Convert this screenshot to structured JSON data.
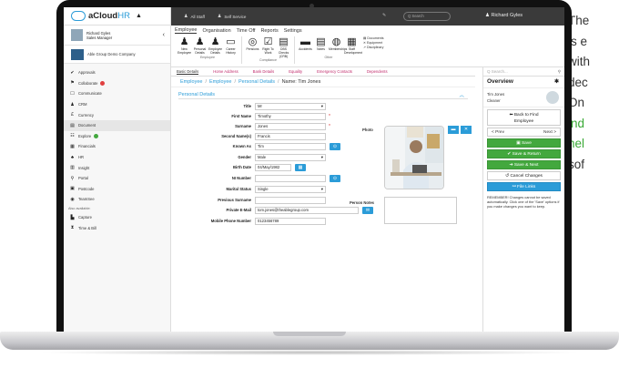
{
  "side_text": {
    "lines": [
      "The",
      "is e",
      "with",
      "dec",
      "On",
      "ind",
      "hel",
      "sof"
    ]
  },
  "sidebar": {
    "logo_a": "aCloud",
    "logo_b": "HR",
    "user_name_line1": "Richard Gyles",
    "user_name_line2": "Sales Manager",
    "company": "Able Group Demo Company",
    "items": [
      {
        "label": "Approvals",
        "icon": "check-circle-icon",
        "glyph": "✔"
      },
      {
        "label": "Collaborate",
        "icon": "people-icon",
        "glyph": "⚑",
        "badge": "#e04040"
      },
      {
        "label": "Communicate",
        "icon": "chat-icon",
        "glyph": "☐"
      },
      {
        "label": "CRM",
        "icon": "crm-icon",
        "glyph": "♟"
      },
      {
        "label": "Currency",
        "icon": "currency-icon",
        "glyph": "£"
      },
      {
        "label": "Document",
        "icon": "document-icon",
        "glyph": "▤",
        "active": true
      },
      {
        "label": "Explore",
        "icon": "explore-icon",
        "glyph": "☷",
        "badge": "#43a83e"
      },
      {
        "label": "Financials",
        "icon": "financials-icon",
        "glyph": "▦"
      },
      {
        "label": "HR",
        "icon": "hr-icon",
        "glyph": "♣"
      },
      {
        "label": "Insight",
        "icon": "insight-icon",
        "glyph": "▥"
      },
      {
        "label": "Portal",
        "icon": "portal-icon",
        "glyph": "⚲"
      },
      {
        "label": "Postcode",
        "icon": "postcode-icon",
        "glyph": "▣"
      },
      {
        "label": "TeamSee",
        "icon": "teamsee-icon",
        "glyph": "◉"
      }
    ],
    "also_available": "Also available:",
    "extra_items": [
      {
        "label": "Capture",
        "icon": "capture-icon",
        "glyph": "▙"
      },
      {
        "label": "Time & Bill",
        "icon": "hourglass-icon",
        "glyph": "⧗"
      }
    ]
  },
  "topbar": {
    "all_staff": "All Staff",
    "self_service": "Self Service",
    "search_placeholder": "Q Search",
    "user": "Richard Gyles"
  },
  "ribbon": {
    "tabs": [
      "Employee",
      "Organisation",
      "Time Off",
      "Reports",
      "Settings"
    ],
    "employee_buttons": [
      {
        "label": "New Employee",
        "icon": "new-employee-icon"
      },
      {
        "label": "Personal Details",
        "icon": "person-icon"
      },
      {
        "label": "Employee Details",
        "icon": "person-icon"
      },
      {
        "label": "Career History",
        "icon": "career-icon"
      }
    ],
    "employee_group": "Employee",
    "compliance_buttons": [
      {
        "label": "Pensions",
        "icon": "pensions-icon"
      },
      {
        "label": "Right To Work",
        "icon": "checkbox-icon"
      },
      {
        "label": "DBS Checks (CRB)",
        "icon": "dbs-icon"
      }
    ],
    "compliance_group": "Compliance",
    "other_buttons": [
      {
        "label": "Accidents",
        "icon": "car-icon"
      },
      {
        "label": "Notes",
        "icon": "notes-icon"
      },
      {
        "label": "Memberships",
        "icon": "membership-icon"
      },
      {
        "label": "Staff Development",
        "icon": "development-icon"
      }
    ],
    "other_group": "Other",
    "doc_links": [
      "Documents",
      "Equipment",
      "Disciplinary"
    ]
  },
  "subtabs": [
    "Basic Details",
    "Home Address",
    "Bank Details",
    "Equality",
    "Emergency Contacts",
    "Dependents"
  ],
  "breadcrumb": {
    "a": "Employee",
    "b": "Employee",
    "c": "Personal Details",
    "cur": "Name: Tim Jones"
  },
  "panel_title": "Personal Details",
  "form": {
    "title": {
      "label": "Title",
      "value": "Mr"
    },
    "first_name": {
      "label": "First Name",
      "value": "Timothy"
    },
    "surname": {
      "label": "Surname",
      "value": "Jones"
    },
    "second_names": {
      "label": "Second Name(s)",
      "value": "Francis"
    },
    "known_as": {
      "label": "Known As",
      "value": "Tim"
    },
    "gender": {
      "label": "Gender",
      "value": "Male"
    },
    "birth_date": {
      "label": "Birth Date",
      "value": "04/May/1982"
    },
    "ni_number": {
      "label": "NI Number",
      "value": ""
    },
    "marital_status": {
      "label": "Marital Status",
      "value": "Single"
    },
    "previous_surname": {
      "label": "Previous Surname",
      "value": ""
    },
    "private_email": {
      "label": "Private E-Mail",
      "value": "tom.jones@theablegroup.com"
    },
    "mobile": {
      "label": "Mobile Phone Number",
      "value": "0123456789"
    },
    "photo_label": "Photo",
    "notes_label": "Person Notes",
    "required_mark": "*"
  },
  "overview": {
    "search_placeholder": "Q Search...",
    "title": "Overview",
    "emp_name": "Tim Jones",
    "emp_role": "Cleaner",
    "back_line1": "Back to Find",
    "back_line2": "Employee",
    "prev": "< Prev",
    "next": "Next >",
    "save": "Save",
    "save_return": "Save & Return",
    "save_next": "Save & Next",
    "cancel": "Cancel Changes",
    "file_links": "File Links",
    "note": "REMEMBER! Changes cannot be saved automatically. Click one of the 'Save' options if you make changes you want to keep."
  },
  "colors": {
    "accent": "#2b9cd8",
    "green": "#43a83e",
    "topbar": "#3a3a3a",
    "pink": "#c02a6b"
  }
}
